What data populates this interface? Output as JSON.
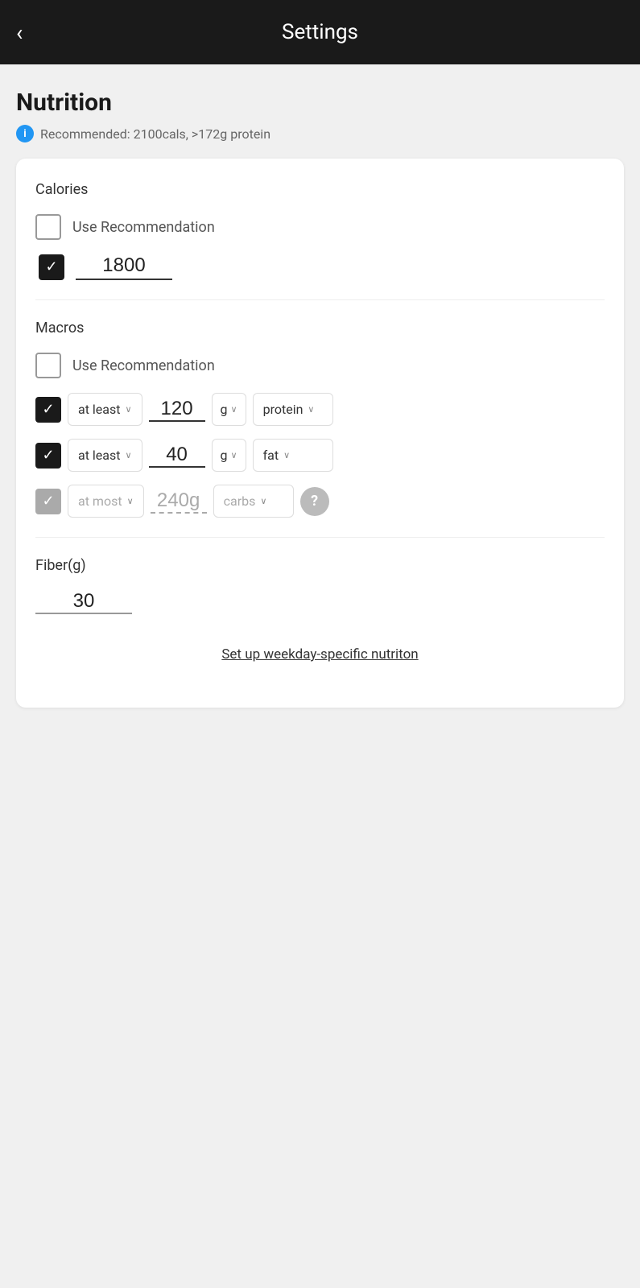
{
  "header": {
    "title": "Settings",
    "back_label": "‹"
  },
  "page": {
    "section_title": "Nutrition",
    "recommendation_text": "Recommended: 2100cals, >172g protein",
    "info_icon_label": "i"
  },
  "calories": {
    "label": "Calories",
    "use_recommendation_label": "Use Recommendation",
    "use_recommendation_checked": false,
    "custom_checked": true,
    "value": "1800"
  },
  "macros": {
    "label": "Macros",
    "use_recommendation_label": "Use Recommendation",
    "use_recommendation_checked": false,
    "rows": [
      {
        "checked": true,
        "checked_style": "black",
        "condition": "at least",
        "value": "120",
        "unit": "g",
        "nutrient": "protein",
        "show_question": false
      },
      {
        "checked": true,
        "checked_style": "black",
        "condition": "at least",
        "value": "40",
        "unit": "g",
        "nutrient": "fat",
        "show_question": false
      },
      {
        "checked": true,
        "checked_style": "gray",
        "condition": "at most",
        "value": "240g",
        "unit": "",
        "nutrient": "carbs",
        "show_question": true
      }
    ]
  },
  "fiber": {
    "label": "Fiber(g)",
    "value": "30"
  },
  "footer": {
    "link_text": "Set up weekday-specific nutriton"
  },
  "icons": {
    "chevron": "∨",
    "checkmark": "✓",
    "question": "?"
  }
}
